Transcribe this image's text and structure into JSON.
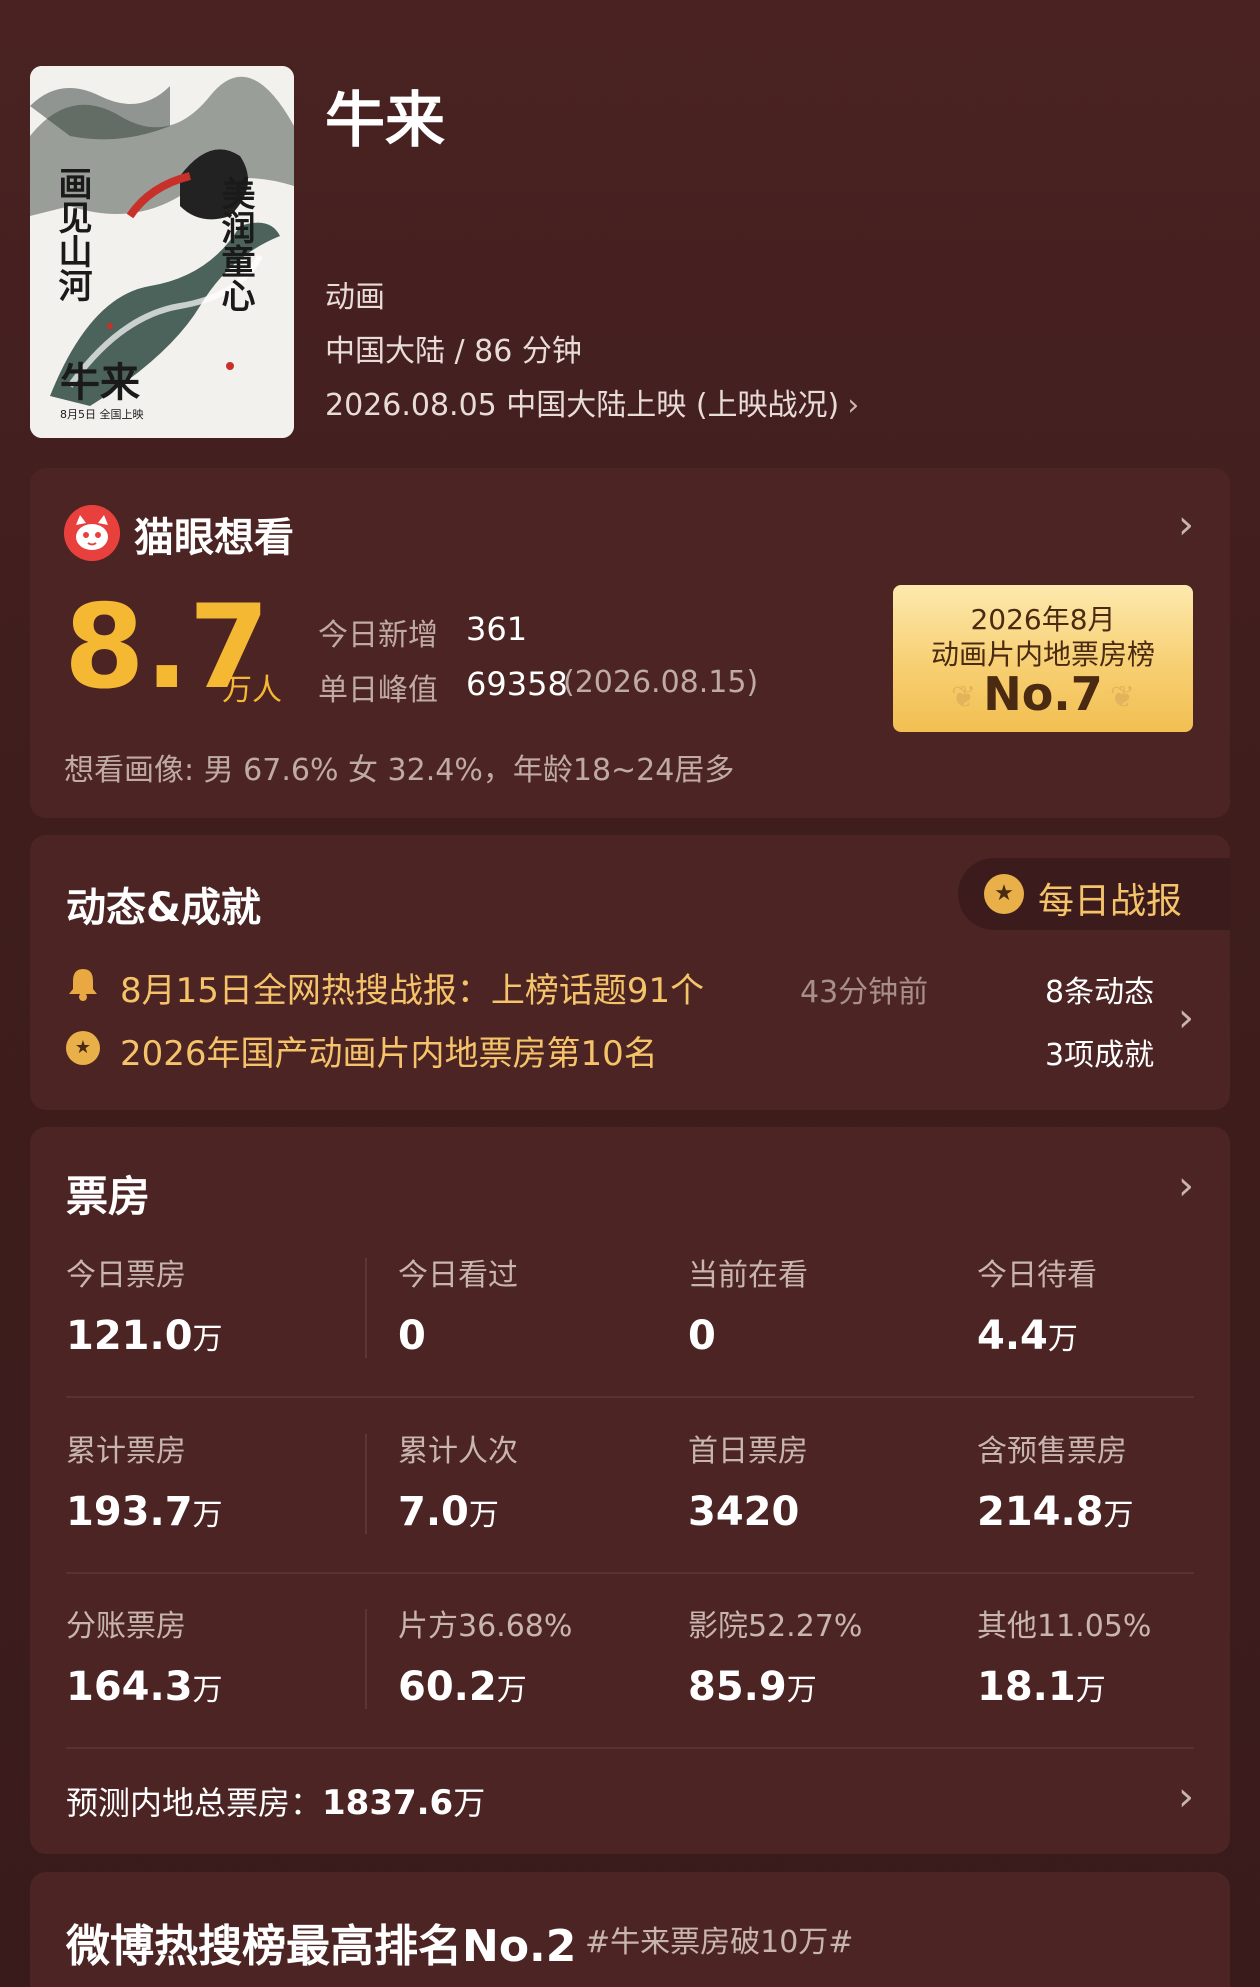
{
  "movie": {
    "title": "牛来",
    "genre": "动画",
    "region_duration": "中国大陆 / 86 分钟",
    "release": "2026.08.05 中国大陆上映 (上映战况)",
    "poster_texts": [
      "美润童心",
      "画见山河",
      "牛来",
      "8月5日 全国上映"
    ]
  },
  "wish": {
    "title": "猫眼想看",
    "count": "8.7",
    "unit": "万人",
    "today_new_label": "今日新增",
    "today_new_value": "361",
    "peak_label": "单日峰值",
    "peak_value": "69358",
    "peak_date": "(2026.08.15)",
    "rank_line1": "2026年8月",
    "rank_line2": "动画片内地票房榜",
    "rank_no": "No.7",
    "portrait": "想看画像: 男 67.6%  女 32.4%，年龄18~24居多"
  },
  "dynamics": {
    "title": "动态&成就",
    "daily_report": "每日战报",
    "item1": "8月15日全网热搜战报：上榜话题91个",
    "item1_time": "43分钟前",
    "item1_count": "8条动态",
    "item2": "2026年国产动画片内地票房第10名",
    "item2_count": "3项成就"
  },
  "boxoffice": {
    "title": "票房",
    "rows": [
      [
        {
          "label": "今日票房",
          "value": "121.0",
          "unit": "万"
        },
        {
          "label": "今日看过",
          "value": "0",
          "unit": ""
        },
        {
          "label": "当前在看",
          "value": "0",
          "unit": ""
        },
        {
          "label": "今日待看",
          "value": "4.4",
          "unit": "万"
        }
      ],
      [
        {
          "label": "累计票房",
          "value": "193.7",
          "unit": "万"
        },
        {
          "label": "累计人次",
          "value": "7.0",
          "unit": "万"
        },
        {
          "label": "首日票房",
          "value": "3420",
          "unit": ""
        },
        {
          "label": "含预售票房",
          "value": "214.8",
          "unit": "万"
        }
      ],
      [
        {
          "label": "分账票房",
          "value": "164.3",
          "unit": "万"
        },
        {
          "label": "片方36.68%",
          "value": "60.2",
          "unit": "万"
        },
        {
          "label": "影院52.27%",
          "value": "85.9",
          "unit": "万"
        },
        {
          "label": "其他11.05%",
          "value": "18.1",
          "unit": "万"
        }
      ]
    ],
    "forecast_label": "预测内地总票房：",
    "forecast_value": "1837.6",
    "forecast_unit": "万"
  },
  "weibo": {
    "title": "微博热搜榜最高排名No.2",
    "tag": "#牛来票房破10万#"
  },
  "colors": {
    "accent": "#f5b833",
    "gold_text": "#f5c46a",
    "card": "#4c2424",
    "background": "#3f1d1d"
  }
}
